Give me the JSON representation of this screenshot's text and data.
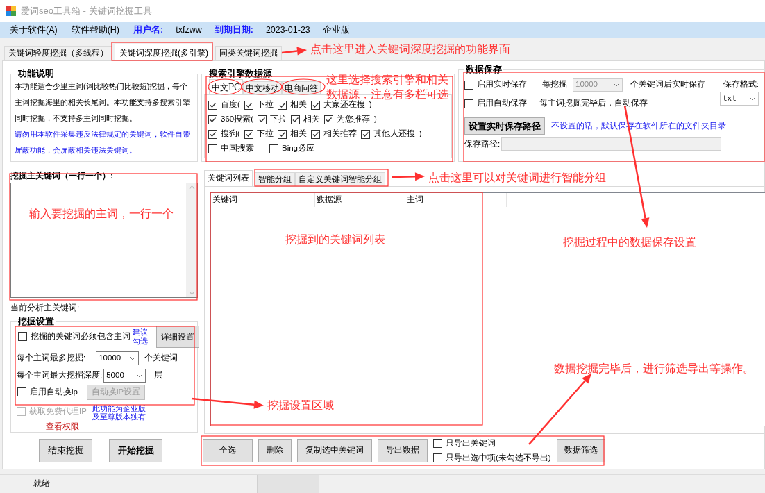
{
  "window": {
    "title": "爱词seo工具箱 - 关键词挖掘工具"
  },
  "menu": [
    {
      "label": "关于软件(A)"
    },
    {
      "label": "软件帮助(H)"
    }
  ],
  "account": [
    {
      "label": "用户名:",
      "value": "txfzww"
    },
    {
      "label": "到期日期:",
      "value": "2023-01-23"
    }
  ],
  "edition": "企业版",
  "tabs": [
    {
      "label": "关键词轻度挖掘（多线程）",
      "selected": false
    },
    {
      "label": "关键词深度挖掘(多引擎)",
      "selected": true
    },
    {
      "label": "同类关键词挖掘",
      "selected": false
    }
  ],
  "description": {
    "title": "功能说明",
    "text": "本功能适合少里主词(词比较热门比较短)挖掘，每个主词挖掘海里的相关长尾词。本功能支持多搜索引擎同时挖掘，不支持多主词同时挖掘。",
    "warning": "请勿用本软件采集违反法律规定的关键词，软件自带屏蔽功能，会屏蔽相关违法关键词。"
  },
  "engines": {
    "title": "搜索引擎数据源",
    "tabs": [
      {
        "label": "中文PC",
        "selected": true
      },
      {
        "label": "中文移动",
        "selected": false
      },
      {
        "label": "电商问答",
        "selected": false
      }
    ],
    "rows": [
      [
        {
          "kind": "checkbox",
          "label": "百度(",
          "checked": true
        },
        {
          "kind": "checkbox",
          "label": "下拉",
          "checked": true
        },
        {
          "kind": "checkbox",
          "label": "相关",
          "checked": true
        },
        {
          "kind": "checkbox",
          "label": "大家还在搜",
          "checked": true
        },
        {
          "kind": "text",
          "label": ")"
        }
      ],
      [
        {
          "kind": "checkbox",
          "label": "360搜索(",
          "checked": true
        },
        {
          "kind": "checkbox",
          "label": "下拉",
          "checked": true
        },
        {
          "kind": "checkbox",
          "label": "相关",
          "checked": true
        },
        {
          "kind": "checkbox",
          "label": "为您推荐",
          "checked": true
        },
        {
          "kind": "text",
          "label": ")"
        }
      ],
      [
        {
          "kind": "checkbox",
          "label": "搜狗(",
          "checked": true
        },
        {
          "kind": "checkbox",
          "label": "下拉",
          "checked": true
        },
        {
          "kind": "checkbox",
          "label": "相关",
          "checked": true
        },
        {
          "kind": "checkbox",
          "label": "相关推荐",
          "checked": true
        },
        {
          "kind": "checkbox",
          "label": "其他人还搜",
          "checked": true
        },
        {
          "kind": "text",
          "label": ")"
        }
      ],
      [
        {
          "kind": "checkbox",
          "label": "中国搜索",
          "checked": false
        },
        {
          "kind": "checkbox",
          "label": "Bing必应",
          "checked": false
        }
      ]
    ]
  },
  "save": {
    "title": "数据保存",
    "realtime": {
      "label": "启用实时保存",
      "checked": false
    },
    "every_label": "每挖掘",
    "every_value": "10000",
    "every_disabled": true,
    "every_suffix": "个关键词后实时保存",
    "format_label": "保存格式:",
    "format_value": "txt",
    "auto": {
      "label": "启用自动保存",
      "checked": false
    },
    "auto_note": "每主词挖掘完毕后，自动保存",
    "path_button": "设置实时保存路径",
    "path_note": "不设置的话，默认保存在软件所在的文件夹目录",
    "path_label": "保存路径:"
  },
  "keywords_label": "挖掘主关键词（一行一个）:",
  "current_label": "当前分析主关键词:",
  "settings": {
    "title": "挖掘设置",
    "must_contain": {
      "label": "挖掘的关键词必须包含主词",
      "checked": false
    },
    "suggest_link": "建议勾选",
    "detail_button": "详细设置",
    "max_label": "每个主词最多挖掘:",
    "max_value": "10000",
    "max_unit": "个关键词",
    "depth_label": "每个主词最大挖掘深度:",
    "depth_value": "5000",
    "depth_unit": "层",
    "auto_ip": {
      "label": "启用自动换ip",
      "checked": false
    },
    "auto_ip_button": {
      "label": "自动换iP设置",
      "disabled": true
    },
    "proxy": {
      "label": "获取免费代理IP",
      "checked": false,
      "disabled": true
    },
    "enterprise_note": "此功能为企业版及至尊版本独有",
    "permission_link": "查看权限"
  },
  "actions": [
    {
      "label": "结束挖掘",
      "kind": "normal"
    },
    {
      "label": "开始挖掘",
      "kind": "default"
    }
  ],
  "result_tabs": [
    {
      "label": "关键词列表",
      "selected": true
    },
    {
      "label": "智能分组",
      "selected": false
    },
    {
      "label": "自定义关键词智能分组",
      "selected": false
    }
  ],
  "table": {
    "columns": [
      "关键词",
      "数据源",
      "主词"
    ]
  },
  "toolbar": {
    "buttons": [
      "全选",
      "删除",
      "复制选中关键词",
      "导出数据"
    ],
    "options": [
      {
        "label": "只导出关键词",
        "checked": false
      },
      {
        "label": "只导出选中项(未勾选不导出)",
        "checked": false
      }
    ],
    "filter_button": "数据筛选"
  },
  "status_bar": {
    "text": "就绪"
  },
  "annotations": [
    {
      "text": "点击这里进入关键词深度挖掘的功能界面"
    },
    {
      "text": "这里选择搜索引擎和相关数据源，注意有多栏可选"
    },
    {
      "text": "点击这里可以对关键词进行智能分组"
    },
    {
      "text": "输入要挖掘的主词，一行一个"
    },
    {
      "text": "挖掘到的关键词列表"
    },
    {
      "text": "挖掘过程中的数据保存设置"
    },
    {
      "text": "数据挖掘完毕后，进行筛选导出等操作。"
    },
    {
      "text": "挖掘设置区域"
    }
  ]
}
